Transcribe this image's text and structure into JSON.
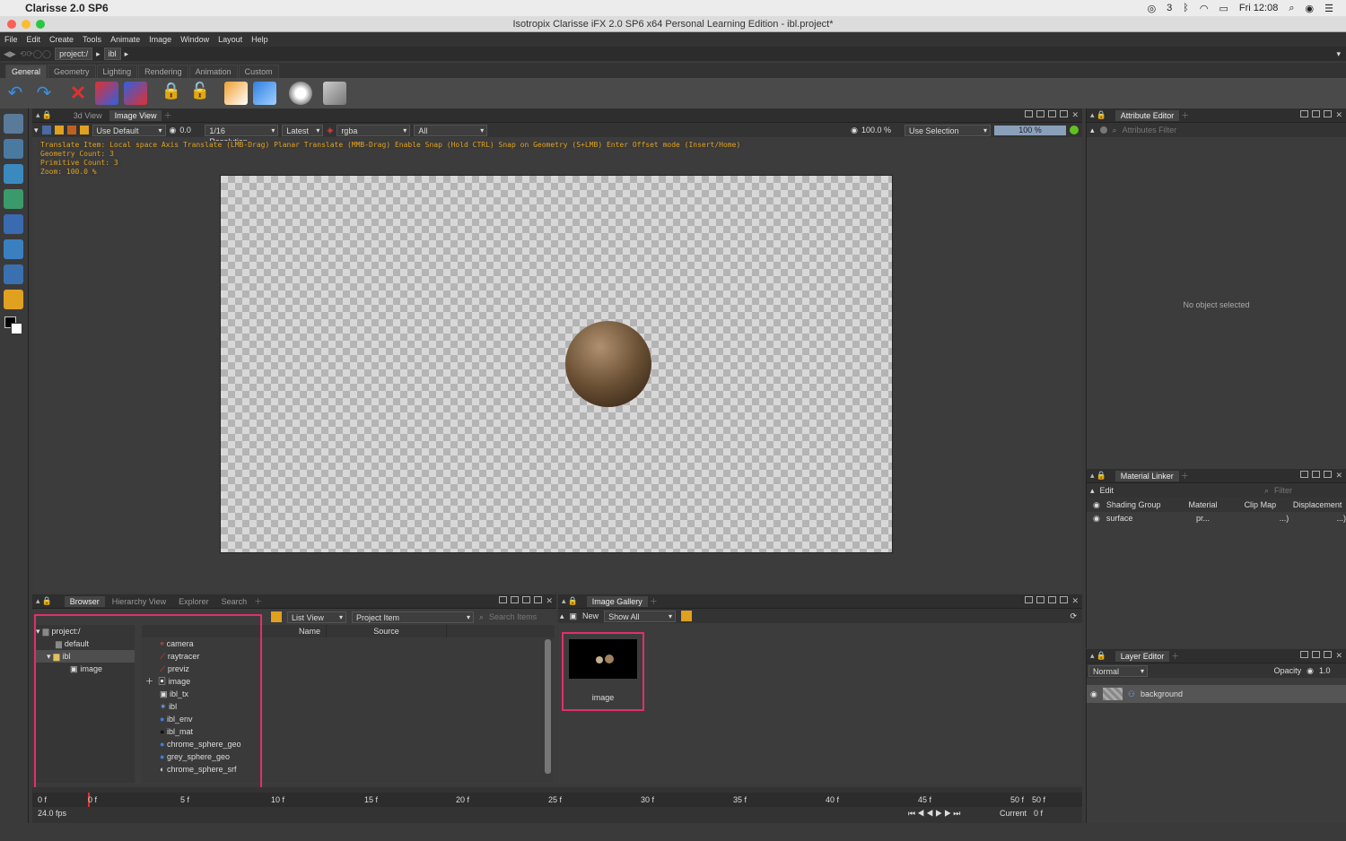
{
  "mac_menubar": {
    "app_name": "Clarisse 2.0 SP6",
    "status_items": [
      "3",
      "Fri 12:08"
    ]
  },
  "window": {
    "title": "Isotropix Clarisse iFX 2.0 SP6 x64 Personal Learning Edition - ibl.project*"
  },
  "app_menu": [
    "File",
    "Edit",
    "Create",
    "Tools",
    "Animate",
    "Image",
    "Window",
    "Layout",
    "Help"
  ],
  "path_bar": {
    "segments": [
      "project:/",
      "ibl"
    ]
  },
  "shelf_tabs": [
    "General",
    "Geometry",
    "Lighting",
    "Rendering",
    "Animation",
    "Custom"
  ],
  "viewport": {
    "tabs": [
      "3d View",
      "Image View"
    ],
    "active_tab": "Image View",
    "display_mode": "Use Default",
    "value": "0.0",
    "resolution": "1/16 Resolution",
    "version": "Latest",
    "channels": "rgba",
    "layers": "All",
    "zoom": "100.0 %",
    "selection": "Use Selection",
    "progress": "100 %",
    "info": [
      "Translate Item: Local space Axis Translate (LMB-Drag)  Planar Translate (MMB-Drag)  Enable Snap (Hold CTRL)  Snap on Geometry (S+LMB)  Enter Offset mode (Insert/Home)",
      "Geometry Count: 3",
      "Primitive Count: 3",
      "Zoom: 100.0 %"
    ]
  },
  "attribute_editor": {
    "title": "Attribute Editor",
    "filter_placeholder": "Attributes Filter",
    "empty_text": "No object selected"
  },
  "material_linker": {
    "title": "Material Linker",
    "edit_label": "Edit",
    "filter_placeholder": "Filter",
    "columns": [
      "Shading Group",
      "Material",
      "Clip Map",
      "Displacement"
    ],
    "rows": [
      {
        "group": "surface",
        "material": "pr...",
        "clip": "...)",
        "disp": "...)"
      }
    ]
  },
  "layer_editor": {
    "title": "Layer Editor",
    "blend": "Normal",
    "opacity_label": "Opacity",
    "opacity": "1.0",
    "layers": [
      "background"
    ]
  },
  "browser": {
    "tabs": [
      "Browser",
      "Hierarchy View",
      "Explorer",
      "Search"
    ],
    "view_mode": "List View",
    "item_type": "Project Item",
    "search_placeholder": "Search Items",
    "tree": [
      {
        "label": "project:/",
        "depth": 0
      },
      {
        "label": "default",
        "depth": 1
      },
      {
        "label": "ibl",
        "depth": 1
      },
      {
        "label": "image",
        "depth": 2
      }
    ],
    "columns": [
      "Name",
      "Source"
    ],
    "items": [
      "camera",
      "raytracer",
      "previz",
      "image",
      "ibl_tx",
      "ibl",
      "ibl_env",
      "ibl_mat",
      "chrome_sphere_geo",
      "grey_sphere_geo",
      "chrome_sphere_srf"
    ]
  },
  "gallery": {
    "title": "Image Gallery",
    "new_label": "New",
    "filter": "Show All",
    "thumb_label": "image"
  },
  "timeline": {
    "start": "0 f",
    "end": "50 f",
    "ticks": [
      "0 f",
      "5 f",
      "10 f",
      "15 f",
      "20 f",
      "25 f",
      "30 f",
      "35 f",
      "40 f",
      "45 f",
      "50 f"
    ],
    "fps": "24.0 fps",
    "current_label": "Current",
    "current": "0 f"
  },
  "colors": {
    "accent": "#e0306a",
    "warning_text": "#e0a020"
  }
}
